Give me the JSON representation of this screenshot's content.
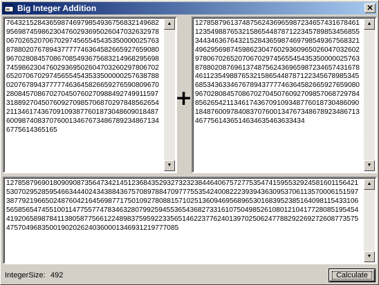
{
  "window": {
    "title": "Big Integer Addition",
    "close_label": "✕"
  },
  "operand_a": {
    "value": "7643215284365987469798549367568321496829569874598623047602936950260470326329780670265207067029745655454353500000257638788020767894377777463645826659276590809670280845708670854936756832149682956987459862304760293695026047032602978067026520706702974565545435335000002576387880207678943777774636458266592765908096702808457086702704507602709884927499115973188927045076092709857068702978485626542113461743670910938776018730486090184876009874083707600134676734867892348671346775614365165"
  },
  "operator": "+",
  "operand_b": {
    "value": "1278587961374875624369659872346574316784611235498876532158654487871223457898534568553443463676432152843659874697985493675683214962956987459862304760293609650260470326029780670265207067029745655454353500000257638788020876961374875624369659872346574316784611235498876532158654487871223456789853456853436334676789437777463645826659276590809670280845708670270450760927098570687297848562654211346174367091093487760187304860901848760097840837076001347673486789234867134677561436514634635463633434"
  },
  "result": {
    "value": "12785879690180909087356473421451236843529327323238446406757277535474159553292458160115642153070295285954663444024343884367570897884709777553542400822239394363095370611357000615159738779219665024876042164569877175010927808815710251360946956896530168395238516409811543310656585654745510011477557747834632807992594553654368273316107504985261080121041772808519545441920658987841138058775661224898375959223356514622377624013970250624778829226927260877357547570496835001902026240360001346931219777085"
  },
  "status": {
    "size_label": "IntegerSize:",
    "size_value": "492"
  },
  "actions": {
    "calculate_label": "Calculate"
  },
  "colors": {
    "title_gradient_start": "#0a246a",
    "title_gradient_end": "#a6caf0",
    "face": "#d4d0c8"
  },
  "icons": {
    "app": "app-window-icon",
    "close": "close-icon",
    "scroll_up": "scroll-up-arrow-icon",
    "scroll_down": "scroll-down-arrow-icon"
  }
}
